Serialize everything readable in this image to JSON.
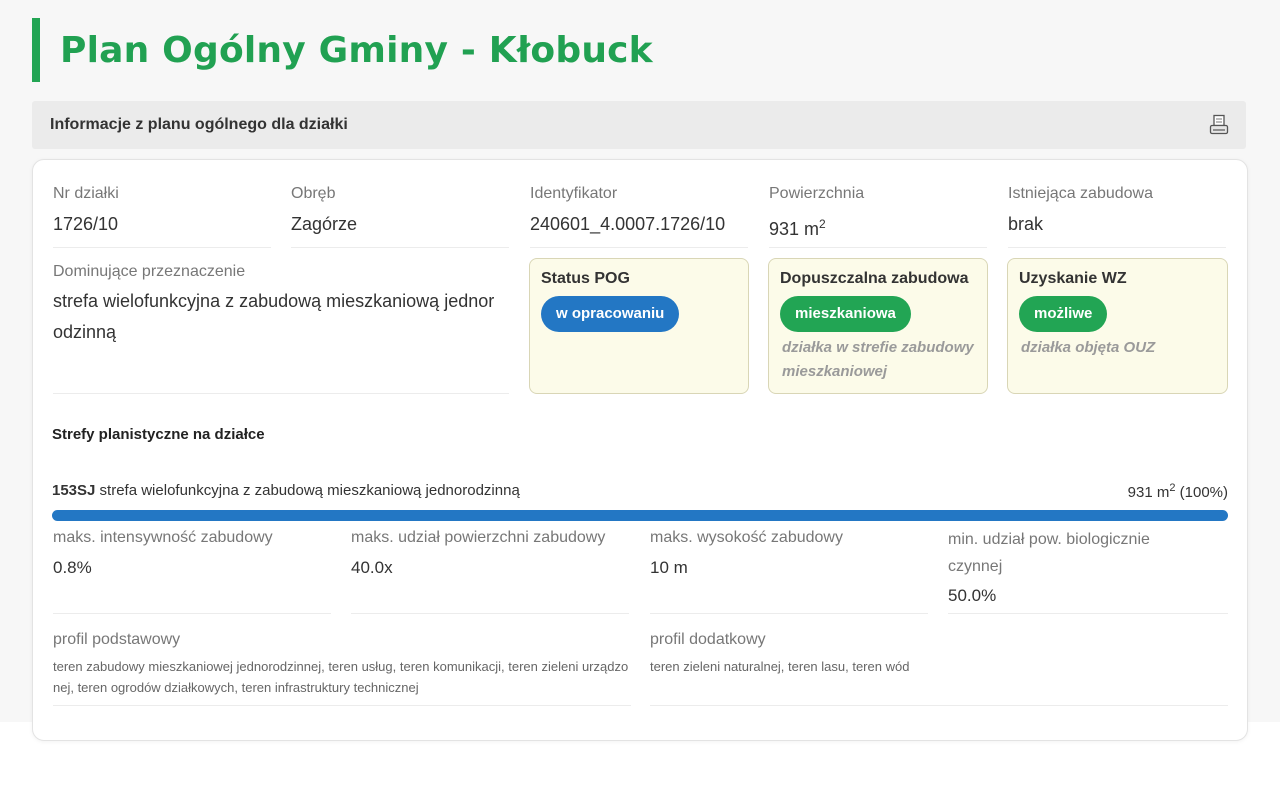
{
  "page": {
    "title": "Plan Ogólny Gminy - Kłobuck",
    "section_title": "Informacje z planu ogólnego dla działki",
    "print_icon": "printer-icon"
  },
  "parcel": {
    "nr_label": "Nr działki",
    "nr_value": "1726/10",
    "obreb_label": "Obręb",
    "obreb_value": "Zagórze",
    "id_label": "Identyfikator",
    "id_value": "240601_4.0007.1726/10",
    "area_label": "Powierzchnia",
    "area_value": "931 m",
    "area_sup": "2",
    "existing_label": "Istniejąca zabudowa",
    "existing_value": "brak",
    "dominant_label": "Dominujące przeznaczenie",
    "dominant_value": "strefa wielofunkcyjna z zabudową mieszkaniową jednorodzinną"
  },
  "status_boxes": [
    {
      "title": "Status POG",
      "badge": "w opracowaniu",
      "badge_color": "#2377c4",
      "note": ""
    },
    {
      "title": "Dopuszczalna zabudowa",
      "badge": "mieszkaniowa",
      "badge_color": "#22a554",
      "note": "działka w strefie zabudowy mieszkaniowej"
    },
    {
      "title": "Uzyskanie WZ",
      "badge": "możliwe",
      "badge_color": "#22a554",
      "note": "działka objęta OUZ"
    }
  ],
  "zones": {
    "heading": "Strefy planistyczne na działce",
    "items": [
      {
        "code": "153SJ",
        "name": "strefa wielofunkcyjna z zabudową mieszkaniową jednorodzinną",
        "area": "931 m",
        "area_sup": "2",
        "share_text": " (100%)",
        "share_fraction": 1.0
      }
    ]
  },
  "params": [
    {
      "label": "maks. intensywność zabudowy",
      "value": "0.8%"
    },
    {
      "label": "maks. udział powierzchni zabudowy",
      "value": "40.0x"
    },
    {
      "label": "maks. wysokość zabudowy",
      "value": "10 m"
    },
    {
      "label": "min. udział pow. biologicznie czynnej",
      "value": "50.0%"
    }
  ],
  "profiles": [
    {
      "label": "profil podstawowy",
      "text": "teren zabudowy mieszkaniowej jednorodzinnej, teren usług, teren komunikacji, teren zieleni urządzonej, teren ogrodów działkowych, teren infrastruktury technicznej"
    },
    {
      "label": "profil dodatkowy",
      "text": "teren zieleni naturalnej, teren lasu, teren wód"
    }
  ],
  "colors": {
    "accent_green": "#22a554",
    "accent_blue": "#2377c4",
    "box_bg": "#fcfbe9"
  }
}
